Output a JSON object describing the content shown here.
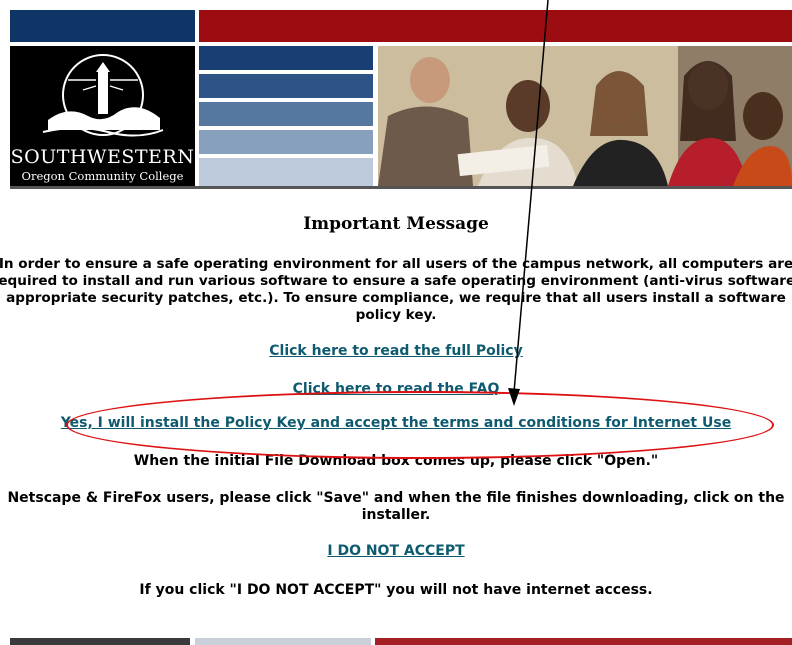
{
  "logo": {
    "name_line1": "SOUTHWESTERN",
    "name_line2": "Oregon Community College",
    "icon": "lighthouse-icon"
  },
  "main": {
    "heading": "Important Message",
    "intro": "In order to ensure a safe operating environment for all users of the campus network, all computers are required to install and run various software to ensure a safe operating environment (anti-virus software, appropriate security patches, etc.). To ensure compliance, we require that all users install a software policy key.",
    "links": {
      "policy": "Click here to read the full Policy",
      "faq": "Click here to read the FAQ",
      "accept": "Yes, I will install the Policy Key and accept the terms and conditions for Internet Use",
      "decline": "I DO NOT ACCEPT"
    },
    "download_note": "When the initial File Download box comes up, please click \"Open.\"",
    "netscape_note": "Netscape & FireFox users, please click \"Save\" and when the file finishes downloading, click on the installer.",
    "decline_warning": "If you click \"I DO NOT ACCEPT\" you will not have internet access."
  },
  "colors": {
    "navy": "#0f3466",
    "red": "#9b0d11",
    "link": "#0e5a6f",
    "annotation": "#dd1111"
  }
}
